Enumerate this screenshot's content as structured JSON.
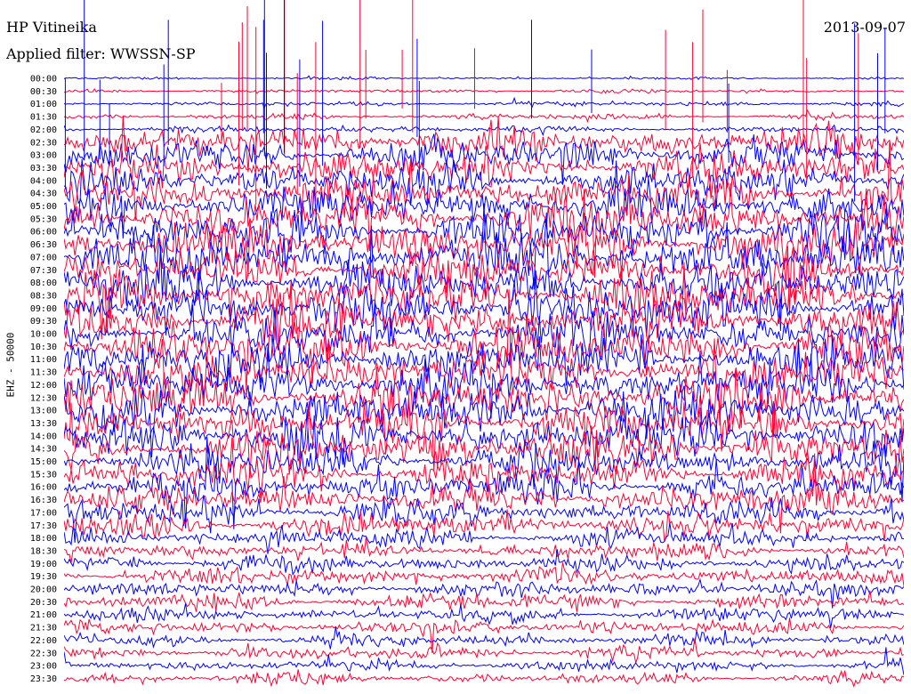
{
  "header": {
    "station": "HP Vitineika",
    "filter": "Applied filter: WWSSN-SP",
    "date": "2013-09-07"
  },
  "chart_data": {
    "type": "line",
    "ylabel": "EHZ - 50000",
    "xlabel": "",
    "rows": [
      "00:00",
      "00:30",
      "01:00",
      "01:30",
      "02:00",
      "02:30",
      "03:00",
      "03:30",
      "04:00",
      "04:30",
      "05:00",
      "05:30",
      "06:00",
      "06:30",
      "07:00",
      "07:30",
      "08:00",
      "08:30",
      "09:00",
      "09:30",
      "10:00",
      "10:30",
      "11:00",
      "11:30",
      "12:00",
      "12:30",
      "13:00",
      "13:30",
      "14:00",
      "14:30",
      "15:00",
      "15:30",
      "16:00",
      "16:30",
      "17:00",
      "17:30",
      "18:00",
      "18:30",
      "19:00",
      "19:30",
      "20:00",
      "20:30",
      "21:00",
      "21:30",
      "22:00",
      "22:30",
      "23:00",
      "23:30"
    ],
    "colors": [
      "#0000ff",
      "#ff0033"
    ],
    "background": "#ffffff",
    "grid": false
  }
}
